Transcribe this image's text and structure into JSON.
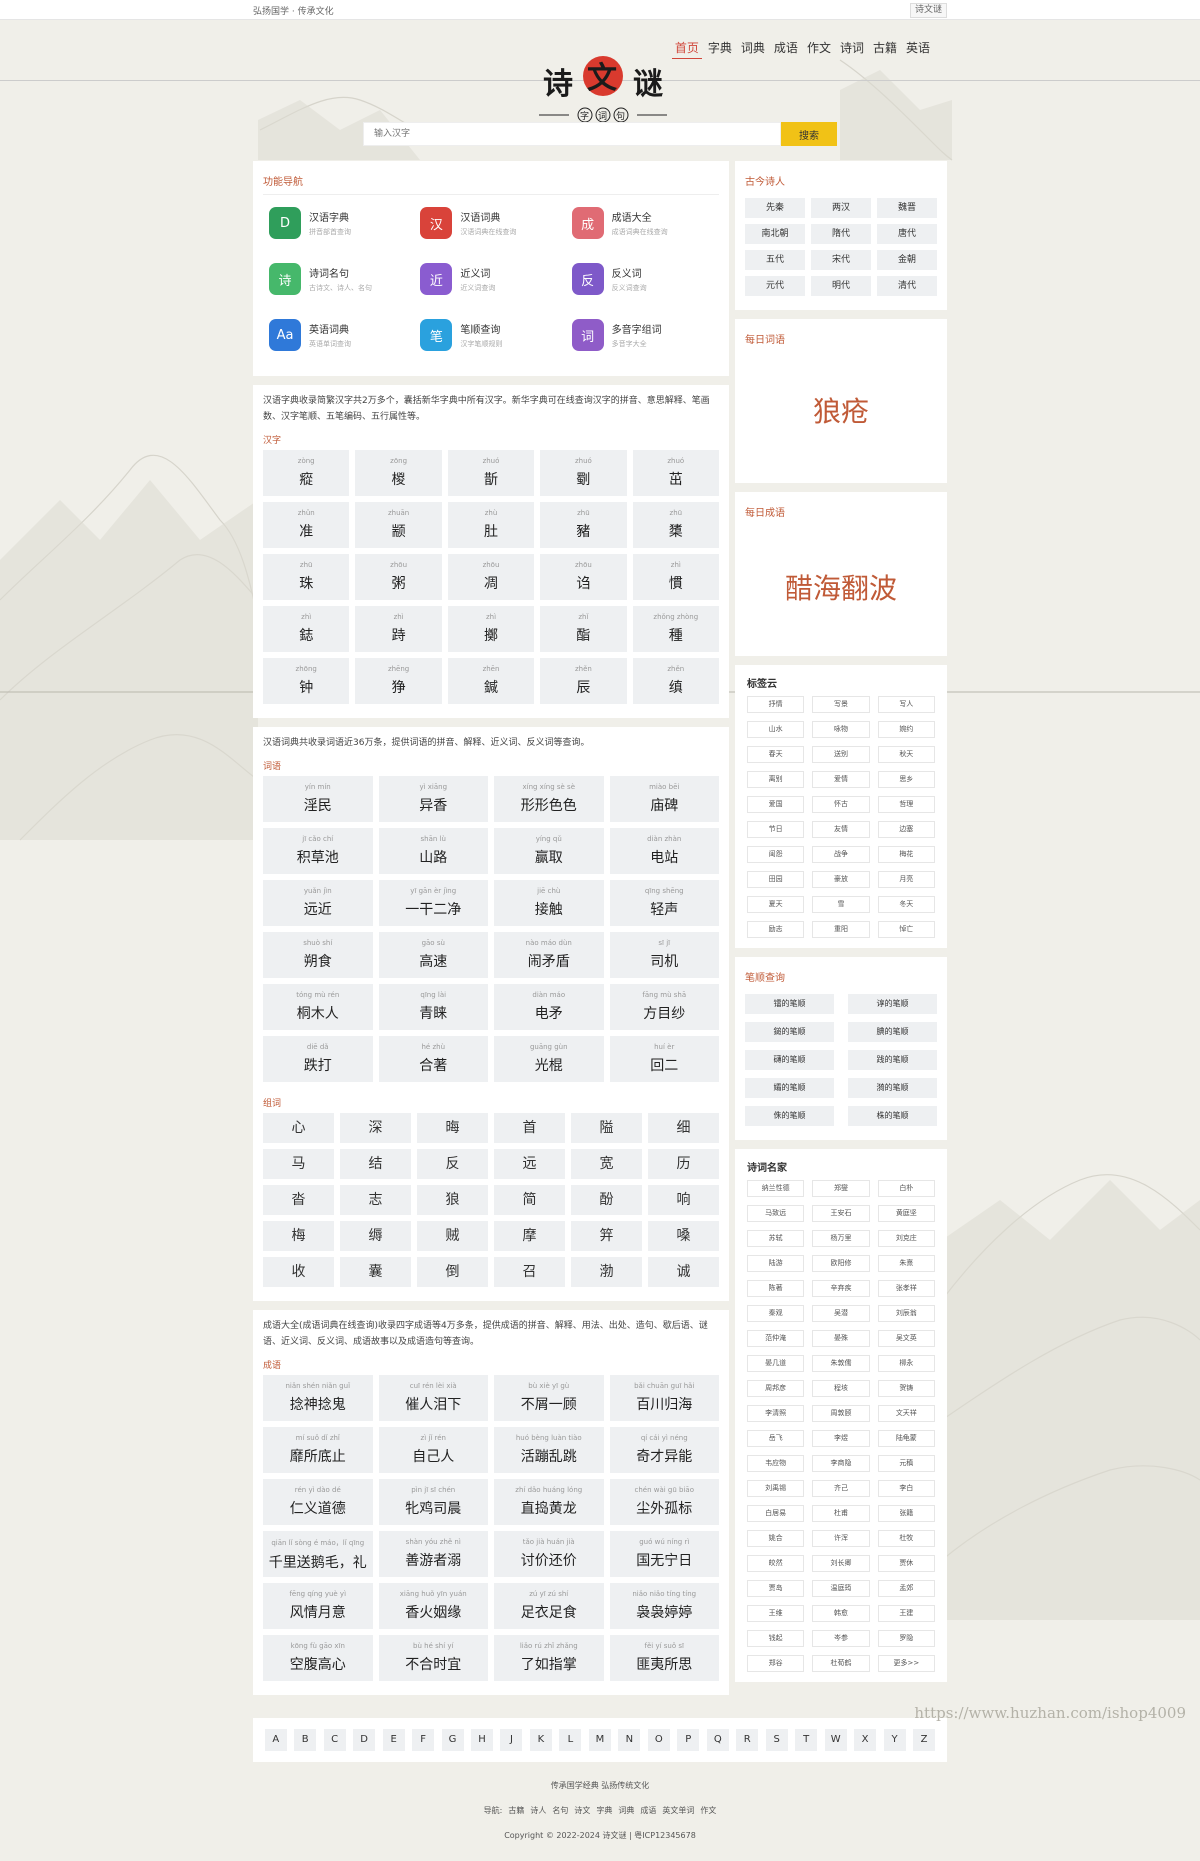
{
  "topbar": {
    "slogan": "弘扬国学 · 传承文化",
    "login": "诗文谜"
  },
  "logo": {
    "title": "诗文谜",
    "subtitle": "字词句"
  },
  "nav": [
    "首页",
    "字典",
    "词典",
    "成语",
    "作文",
    "诗词",
    "古籍",
    "英语"
  ],
  "search": {
    "placeholder": "输入汉字",
    "button": "搜索"
  },
  "func": {
    "title": "功能导航",
    "items": [
      {
        "name": "汉语字典",
        "desc": "拼音部首查询",
        "icon": "dictionary-icon",
        "glyph": "D",
        "color": "#2f9e5b"
      },
      {
        "name": "汉语词典",
        "desc": "汉语词典在线查询",
        "icon": "word-dictionary-icon",
        "glyph": "汉",
        "color": "#d9433a"
      },
      {
        "name": "成语大全",
        "desc": "成语词典在线查询",
        "icon": "idiom-icon",
        "glyph": "成",
        "color": "#e06b74"
      },
      {
        "name": "诗词名句",
        "desc": "古诗文、诗人、名句",
        "icon": "poem-icon",
        "glyph": "诗",
        "color": "#46b86b"
      },
      {
        "name": "近义词",
        "desc": "近义词查询",
        "icon": "synonym-icon",
        "glyph": "近",
        "color": "#8a5cd0"
      },
      {
        "name": "反义词",
        "desc": "反义词查询",
        "icon": "antonym-icon",
        "glyph": "反",
        "color": "#7e59c9"
      },
      {
        "name": "英语词典",
        "desc": "英语单词查询",
        "icon": "english-icon",
        "glyph": "Aa",
        "color": "#2f79d9"
      },
      {
        "name": "笔顺查询",
        "desc": "汉字笔顺规则",
        "icon": "stroke-icon",
        "glyph": "笔",
        "color": "#2aa1de"
      },
      {
        "name": "多音字组词",
        "desc": "多音字大全",
        "icon": "polyphone-icon",
        "glyph": "词",
        "color": "#8f5cc8"
      }
    ]
  },
  "hanzi": {
    "desc": "汉语字典收录简繁汉字共2万多个，囊括新华字典中所有汉字。新华字典可在线查询汉字的拼音、意思解释、笔画数、汉字笔顺、五笔编码、五行属性等。",
    "label": "汉字",
    "items": [
      {
        "py": "zòng",
        "ch": "瘲"
      },
      {
        "py": "zōng",
        "ch": "椶"
      },
      {
        "py": "zhuó",
        "ch": "斮"
      },
      {
        "py": "zhuó",
        "ch": "劅"
      },
      {
        "py": "zhuó",
        "ch": "茁"
      },
      {
        "py": "zhǔn",
        "ch": "准"
      },
      {
        "py": "zhuān",
        "ch": "颛"
      },
      {
        "py": "zhù",
        "ch": "肚"
      },
      {
        "py": "zhū",
        "ch": "豬"
      },
      {
        "py": "zhū",
        "ch": "橥"
      },
      {
        "py": "zhū",
        "ch": "珠"
      },
      {
        "py": "zhōu",
        "ch": "粥"
      },
      {
        "py": "zhōu",
        "ch": "凋"
      },
      {
        "py": "zhōu",
        "ch": "诌"
      },
      {
        "py": "zhì",
        "ch": "慣"
      },
      {
        "py": "zhì",
        "ch": "鋕"
      },
      {
        "py": "zhì",
        "ch": "跱"
      },
      {
        "py": "zhì",
        "ch": "擲"
      },
      {
        "py": "zhǐ",
        "ch": "酯"
      },
      {
        "py": "zhǒng zhòng",
        "ch": "種"
      },
      {
        "py": "zhōng",
        "ch": "钟"
      },
      {
        "py": "zhēng",
        "ch": "狰"
      },
      {
        "py": "zhēn",
        "ch": "鍼"
      },
      {
        "py": "zhěn",
        "ch": "辰"
      },
      {
        "py": "zhěn",
        "ch": "缜"
      }
    ]
  },
  "cidian": {
    "desc": "汉语词典共收录词语近36万条，提供词语的拼音、解释、近义词、反义词等查询。",
    "label": "词语",
    "items": [
      {
        "py": "yín mín",
        "ch": "淫民"
      },
      {
        "py": "yì xiāng",
        "ch": "异香"
      },
      {
        "py": "xíng xíng sè sè",
        "ch": "形形色色"
      },
      {
        "py": "miào bēi",
        "ch": "庙碑"
      },
      {
        "py": "jī cǎo chí",
        "ch": "积草池"
      },
      {
        "py": "shān lù",
        "ch": "山路"
      },
      {
        "py": "yíng qǔ",
        "ch": "赢取"
      },
      {
        "py": "diàn zhàn",
        "ch": "电站"
      },
      {
        "py": "yuǎn jìn",
        "ch": "远近"
      },
      {
        "py": "yī gān èr jìng",
        "ch": "一干二净"
      },
      {
        "py": "jiē chù",
        "ch": "接触"
      },
      {
        "py": "qīng shēng",
        "ch": "轻声"
      },
      {
        "py": "shuò shí",
        "ch": "朔食"
      },
      {
        "py": "gāo sù",
        "ch": "高速"
      },
      {
        "py": "nào máo dùn",
        "ch": "闹矛盾"
      },
      {
        "py": "sī jī",
        "ch": "司机"
      },
      {
        "py": "tóng mù rén",
        "ch": "桐木人"
      },
      {
        "py": "qīng lài",
        "ch": "青睐"
      },
      {
        "py": "diàn máo",
        "ch": "电矛"
      },
      {
        "py": "fāng mù shā",
        "ch": "方目纱"
      },
      {
        "py": "diē dǎ",
        "ch": "跌打"
      },
      {
        "py": "hé zhù",
        "ch": "合著"
      },
      {
        "py": "guāng gùn",
        "ch": "光棍"
      },
      {
        "py": "huí èr",
        "ch": "回二"
      }
    ],
    "zuci_label": "组词",
    "zuci": [
      "心",
      "深",
      "晦",
      "首",
      "隘",
      "细",
      "马",
      "结",
      "反",
      "远",
      "宽",
      "历",
      "沓",
      "志",
      "狼",
      "简",
      "酚",
      "响",
      "梅",
      "缛",
      "贼",
      "摩",
      "笄",
      "嗓",
      "收",
      "囊",
      "倒",
      "召",
      "渤",
      "诚"
    ]
  },
  "chengyu": {
    "desc": "成语大全(成语词典在线查询)收录四字成语等4万多条，提供成语的拼音、解释、用法、出处、造句、歇后语、谜语、近义词、反义词、成语故事以及成语造句等查询。",
    "label": "成语",
    "items": [
      {
        "py": "niǎn shén niǎn guǐ",
        "ch": "捻神捻鬼"
      },
      {
        "py": "cuī rén lèi xià",
        "ch": "催人泪下"
      },
      {
        "py": "bù xiè yī gù",
        "ch": "不屑一顾"
      },
      {
        "py": "bǎi chuān guī hǎi",
        "ch": "百川归海"
      },
      {
        "py": "mí suǒ dǐ zhǐ",
        "ch": "靡所底止"
      },
      {
        "py": "zì jǐ rén",
        "ch": "自己人"
      },
      {
        "py": "huó bèng luàn tiào",
        "ch": "活蹦乱跳"
      },
      {
        "py": "qí cái yì néng",
        "ch": "奇才异能"
      },
      {
        "py": "rén yì dào dé",
        "ch": "仁义道德"
      },
      {
        "py": "pìn jī sī chén",
        "ch": "牝鸡司晨"
      },
      {
        "py": "zhí dǎo huáng lóng",
        "ch": "直捣黄龙"
      },
      {
        "py": "chén wài gū biāo",
        "ch": "尘外孤标"
      },
      {
        "py": "qiān lǐ sòng é máo，lǐ qīng",
        "ch": "千里送鹅毛，礼"
      },
      {
        "py": "shàn yóu zhě nì",
        "ch": "善游者溺"
      },
      {
        "py": "tǎo jià huán jià",
        "ch": "讨价还价"
      },
      {
        "py": "guó wú níng rì",
        "ch": "国无宁日"
      },
      {
        "py": "fēng qíng yuè yì",
        "ch": "风情月意"
      },
      {
        "py": "xiāng huǒ yīn yuán",
        "ch": "香火姻缘"
      },
      {
        "py": "zú yī zú shí",
        "ch": "足衣足食"
      },
      {
        "py": "niǎo niǎo tíng tíng",
        "ch": "袅袅婷婷"
      },
      {
        "py": "kōng fù gāo xīn",
        "ch": "空腹高心"
      },
      {
        "py": "bù hé shí yí",
        "ch": "不合时宜"
      },
      {
        "py": "liǎo rú zhǐ zhǎng",
        "ch": "了如指掌"
      },
      {
        "py": "fěi yí suǒ sī",
        "ch": "匪夷所思"
      }
    ]
  },
  "poets": {
    "title": "古今诗人",
    "items": [
      "先秦",
      "两汉",
      "魏晋",
      "南北朝",
      "隋代",
      "唐代",
      "五代",
      "宋代",
      "金朝",
      "元代",
      "明代",
      "清代"
    ]
  },
  "daily_word": {
    "title": "每日词语",
    "word": "狼疮"
  },
  "daily_idiom": {
    "title": "每日成语",
    "word": "醋海翻波"
  },
  "tagcloud": {
    "title": "标签云",
    "items": [
      "抒情",
      "写景",
      "写人",
      "山水",
      "咏物",
      "婉约",
      "春天",
      "送别",
      "秋天",
      "离别",
      "爱情",
      "思乡",
      "爱国",
      "怀古",
      "哲理",
      "节日",
      "友情",
      "边塞",
      "闺怨",
      "战争",
      "梅花",
      "田园",
      "豪放",
      "月亮",
      "夏天",
      "雪",
      "冬天",
      "励志",
      "重阳",
      "悼亡"
    ]
  },
  "strokes": {
    "title": "笔顺查询",
    "items": [
      "镭的笔顺",
      "谆的笔顺",
      "鎚的笔顺",
      "腆的笔顺",
      "礴的笔顺",
      "践的笔顺",
      "孀的笔顺",
      "漪的笔顺",
      "侏的笔顺",
      "株的笔顺"
    ]
  },
  "famous": {
    "title": "诗词名家",
    "items": [
      "纳兰性德",
      "郑燮",
      "白朴",
      "马致远",
      "王安石",
      "黄庭坚",
      "苏轼",
      "杨万里",
      "刘克庄",
      "陆游",
      "欧阳修",
      "朱熹",
      "陈著",
      "辛弃疾",
      "张孝祥",
      "秦观",
      "吴潜",
      "刘辰翁",
      "范仲淹",
      "晏殊",
      "吴文英",
      "晏几道",
      "朱敦儒",
      "柳永",
      "周邦彦",
      "程垓",
      "贺铸",
      "李清照",
      "周敦颐",
      "文天祥",
      "岳飞",
      "李煜",
      "陆龟蒙",
      "韦应物",
      "李商隐",
      "元稹",
      "刘禹锡",
      "齐己",
      "李白",
      "白居易",
      "杜甫",
      "张籍",
      "姚合",
      "许浑",
      "杜牧",
      "皎然",
      "刘长卿",
      "贾休",
      "贾岛",
      "温庭筠",
      "孟郊",
      "王维",
      "韩愈",
      "王建",
      "钱起",
      "岑参",
      "罗隐",
      "郑谷",
      "杜荀鹤",
      "更多>>"
    ]
  },
  "alphabet": [
    "A",
    "B",
    "C",
    "D",
    "E",
    "F",
    "G",
    "H",
    "J",
    "K",
    "L",
    "M",
    "N",
    "O",
    "P",
    "Q",
    "R",
    "S",
    "T",
    "W",
    "X",
    "Y",
    "Z"
  ],
  "footer": {
    "line1": "传承国学经典 弘扬传统文化",
    "nav_label": "导航:",
    "nav": [
      "古籍",
      "诗人",
      "名句",
      "诗文",
      "字典",
      "词典",
      "成语",
      "英文单词",
      "作文"
    ],
    "copyright": "Copyright © 2022-2024 诗文谜 | 粤ICP12345678"
  },
  "watermark": "https://www.huzhan.com/ishop4009"
}
